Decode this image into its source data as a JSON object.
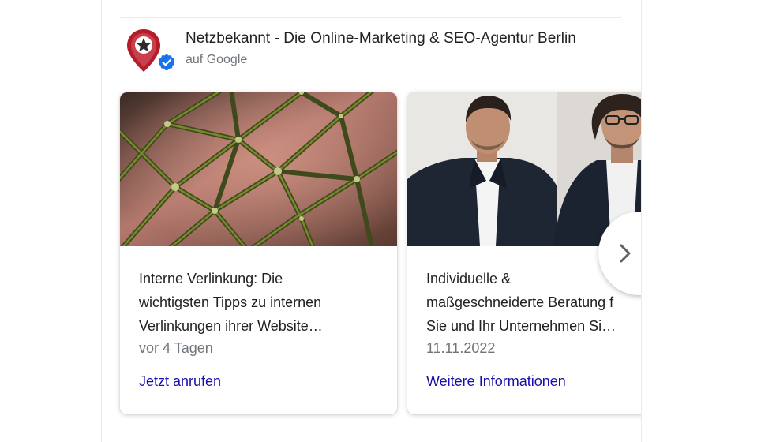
{
  "business": {
    "name": "Netzbekannt - Die Online-Marketing & SEO-Agentur Berlin",
    "source": "auf Google"
  },
  "posts": [
    {
      "title": "Interne Verlinkung: Die\nwichtigsten Tipps zu internen\nVerlinkungen ihrer Website…",
      "date": "vor 4 Tagen",
      "action": "Jetzt anrufen"
    },
    {
      "title": "Individuelle &\nmaßgeschneiderte Beratung f\nSie und Ihr Unternehmen Si…",
      "date": "11.11.2022",
      "action": "Weitere Informationen"
    }
  ],
  "icons": {
    "logo": "map-pin-star-icon",
    "verified": "verified-check-icon",
    "next": "chevron-right-icon"
  },
  "colors": {
    "link": "#1a0dab",
    "verified": "#1a73e8",
    "logo": "#b51c2a"
  }
}
